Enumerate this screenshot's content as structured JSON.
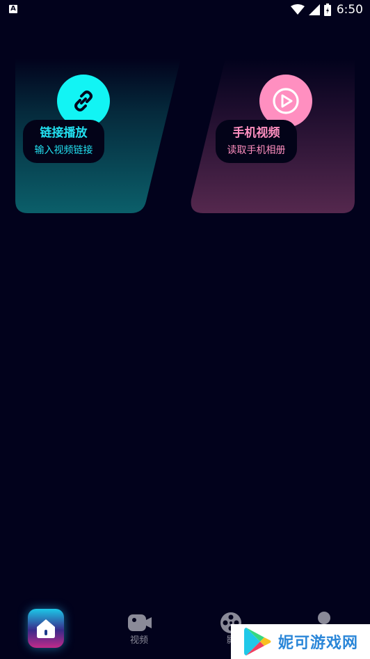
{
  "status_bar": {
    "left_icon": "A",
    "time": "6:50",
    "icons": [
      "wifi-icon",
      "signal-icon",
      "battery-icon"
    ]
  },
  "cards": [
    {
      "title": "链接播放",
      "subtitle": "输入视频链接",
      "icon": "link-icon",
      "accent": "#12f4f4"
    },
    {
      "title": "手机视频",
      "subtitle": "读取手机相册",
      "icon": "play-circle-icon",
      "accent": "#ff8fc0"
    }
  ],
  "bottom_nav": {
    "items": [
      {
        "label": "",
        "icon": "home-icon",
        "active": true
      },
      {
        "label": "视频",
        "icon": "video-camera-icon",
        "active": false
      },
      {
        "label": "影",
        "icon": "film-reel-icon",
        "active": false
      },
      {
        "label": "",
        "icon": "user-icon",
        "active": false
      }
    ]
  },
  "watermark": {
    "text": "妮可游戏网"
  },
  "colors": {
    "background": "#02021c",
    "cyan": "#12f4f4",
    "pink": "#ff8fc0"
  }
}
